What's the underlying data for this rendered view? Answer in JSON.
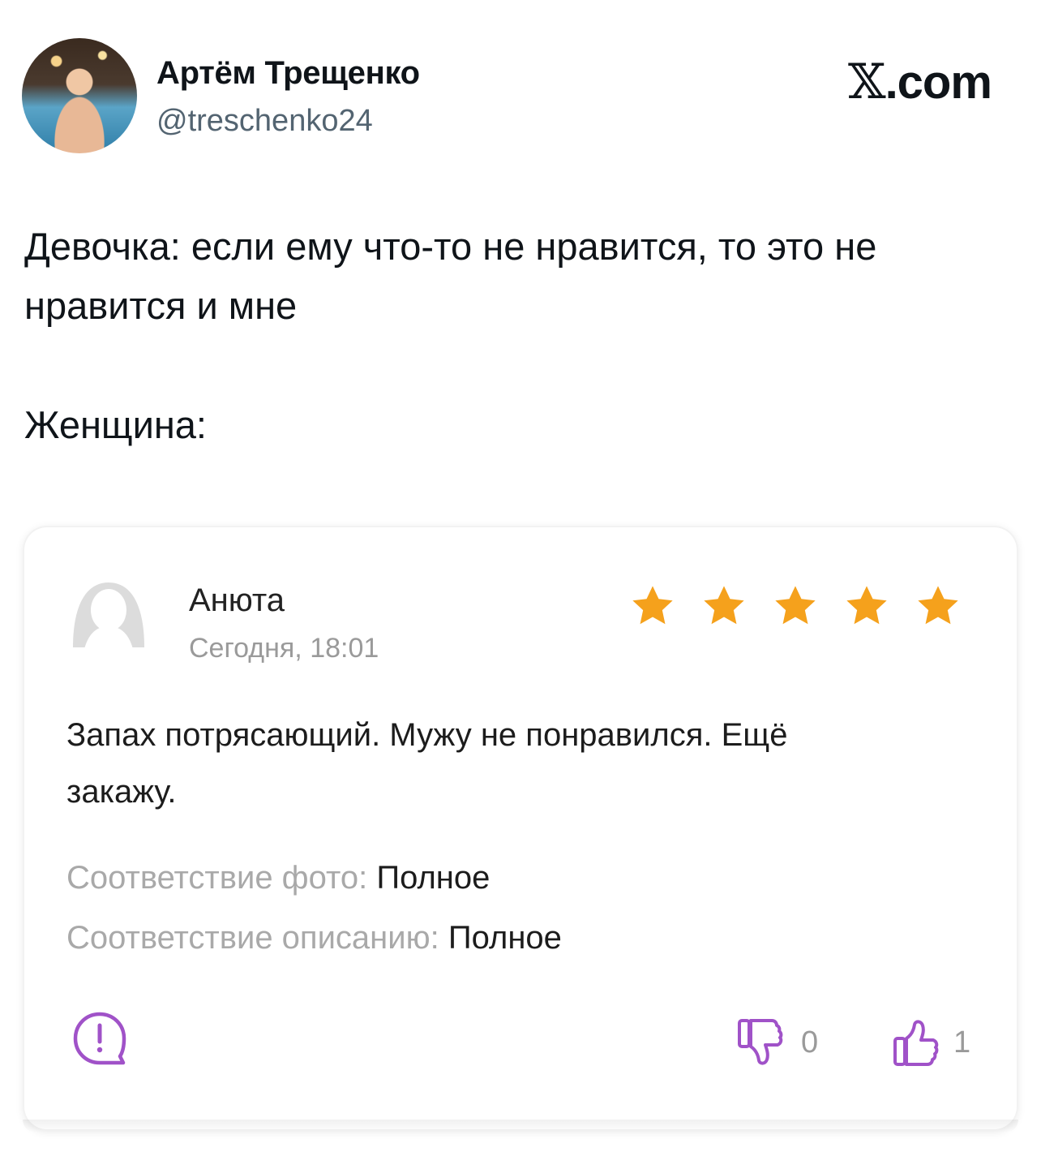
{
  "tweet": {
    "author_name": "Артём Трещенко",
    "author_handle": "@treschenko24",
    "platform_logo_x": "𝕏",
    "platform_logo_text": ".com",
    "text_line1": "Девочка: если ему что-то не нравится, то это не",
    "text_line2": "нравится и мне",
    "text_line3": "Женщина:"
  },
  "review": {
    "author": "Анюта",
    "date": "Сегодня, 18:01",
    "rating": 5,
    "rating_max": 5,
    "text_line1": "Запах потрясающий. Мужу не понравился. Ещё",
    "text_line2": "закажу.",
    "attr1_key": "Соответствие фото:",
    "attr1_value": "Полное",
    "attr2_key": "Соответствие описанию:",
    "attr2_value": "Полное",
    "dislike_count": "0",
    "like_count": "1"
  },
  "colors": {
    "star": "#f5a11c",
    "action_icon": "#a052c8",
    "muted_text": "#a9a9a9"
  },
  "icons": [
    "user-avatar-placeholder-icon",
    "star-icon",
    "report-icon",
    "thumbs-down-icon",
    "thumbs-up-icon"
  ]
}
